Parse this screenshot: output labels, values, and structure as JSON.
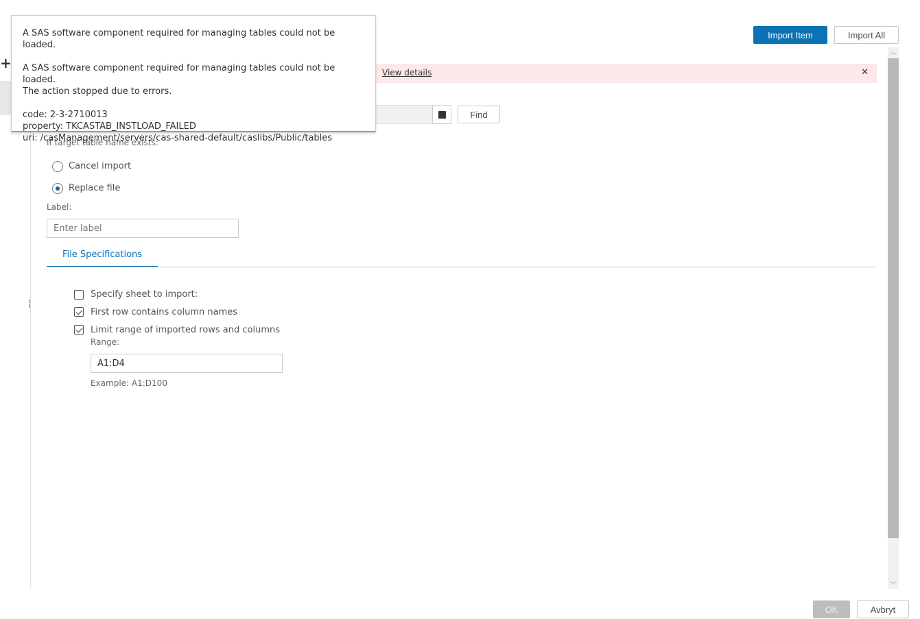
{
  "toolbar": {
    "import_item": "Import Item",
    "import_all": "Import All"
  },
  "error_banner": {
    "link": "View details",
    "close": "✕"
  },
  "popover": {
    "line1": "A SAS software component required for managing tables could not be loaded.",
    "line2": "A SAS software component required for managing tables could not be loaded.",
    "line3": "The action stopped due to errors.",
    "code": "code: 2-3-2710013",
    "property": "property: TKCASTAB_INSTLOAD_FAILED",
    "uri": "uri: /casManagement/servers/cas-shared-default/caslibs/Public/tables"
  },
  "target": {
    "find": "Find",
    "exists_label": "If target table name exists:",
    "options": [
      "Cancel import",
      "Replace file"
    ]
  },
  "label": {
    "title": "Label:",
    "placeholder": "Enter label"
  },
  "tabs": [
    "File Specifications"
  ],
  "filespec": {
    "specify_sheet": "Specify sheet to import:",
    "first_row": "First row contains column names",
    "limit_range": "Limit range of imported rows and columns",
    "range_label": "Range:",
    "range_value": "A1:D4",
    "example": "Example: A1:D100"
  },
  "footer": {
    "ok": "OK",
    "cancel": "Avbryt"
  },
  "sidebar": {
    "add": "+"
  }
}
